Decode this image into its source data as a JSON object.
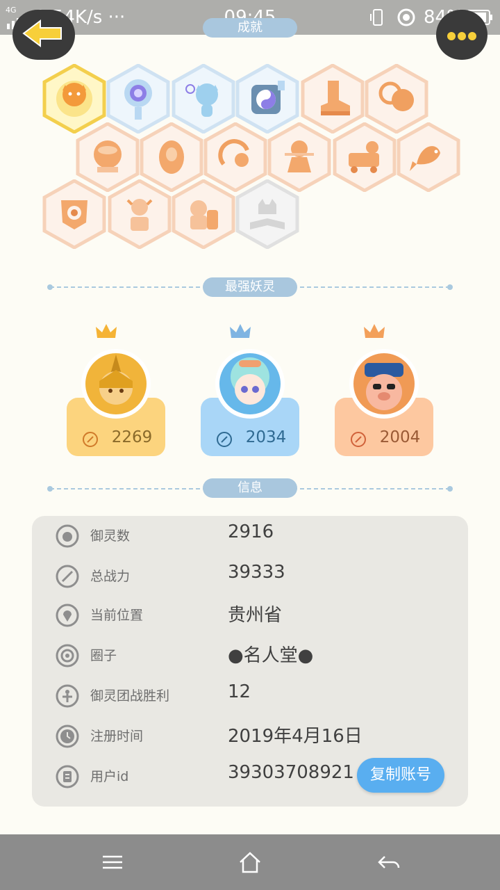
{
  "status_bar": {
    "network": "4G",
    "speed": "0.54K/s ···",
    "time": "09:45",
    "battery": "84%"
  },
  "header": {
    "title": "成就"
  },
  "achievements": {
    "badges": [
      {
        "icon": "fox-moon-badge-icon",
        "state": "gold"
      },
      {
        "icon": "portal-badge-icon",
        "state": "blue"
      },
      {
        "icon": "cat-bubble-badge-icon",
        "state": "blue"
      },
      {
        "icon": "yin-yang-badge-icon",
        "state": "blue"
      },
      {
        "icon": "boots-badge-icon",
        "state": "orange"
      },
      {
        "icon": "moon-badge-icon",
        "state": "orange"
      },
      {
        "icon": "orb-badge-icon",
        "state": "orange"
      },
      {
        "icon": "egg-badge-icon",
        "state": "orange"
      },
      {
        "icon": "swirl-badge-icon",
        "state": "orange"
      },
      {
        "icon": "warrior-badge-icon",
        "state": "orange"
      },
      {
        "icon": "cart-badge-icon",
        "state": "orange"
      },
      {
        "icon": "carp-badge-icon",
        "state": "orange"
      },
      {
        "icon": "shield-badge-icon",
        "state": "orange"
      },
      {
        "icon": "bull-badge-icon",
        "state": "orange"
      },
      {
        "icon": "puzzle-badge-icon",
        "state": "orange"
      },
      {
        "icon": "wolf-book-badge-icon",
        "state": "locked"
      }
    ]
  },
  "top_spirits": {
    "title": "最强妖灵",
    "items": [
      {
        "score": "2269",
        "theme": "gold",
        "card_color": "#fcd47e",
        "text_color": "#8a6a2a"
      },
      {
        "score": "2034",
        "theme": "blue",
        "card_color": "#a9d6f7",
        "text_color": "#2f6a92"
      },
      {
        "score": "2004",
        "theme": "orange",
        "card_color": "#fdc8a0",
        "text_color": "#9a5a35"
      }
    ]
  },
  "info": {
    "title": "信息",
    "rows": [
      {
        "icon": "spirit-icon",
        "label": "御灵数",
        "value": "2916"
      },
      {
        "icon": "sword-icon",
        "label": "总战力",
        "value": "39333"
      },
      {
        "icon": "location-pin-icon",
        "label": "当前位置",
        "value": "贵州省"
      },
      {
        "icon": "circle-group-icon",
        "label": "圈子",
        "value": "●名人堂●"
      },
      {
        "icon": "team-battle-icon",
        "label": "御灵团战胜利",
        "value": "12"
      },
      {
        "icon": "clock-icon",
        "label": "注册时间",
        "value": "2019年4月16日"
      },
      {
        "icon": "id-card-icon",
        "label": "用户id",
        "value": "39303708921"
      }
    ],
    "copy_button": "复制账号"
  },
  "colors": {
    "accent_blue": "#59aef0",
    "pill": "#a9c7de",
    "panel": "#e9e8e3",
    "background": "#fdfcf5"
  }
}
